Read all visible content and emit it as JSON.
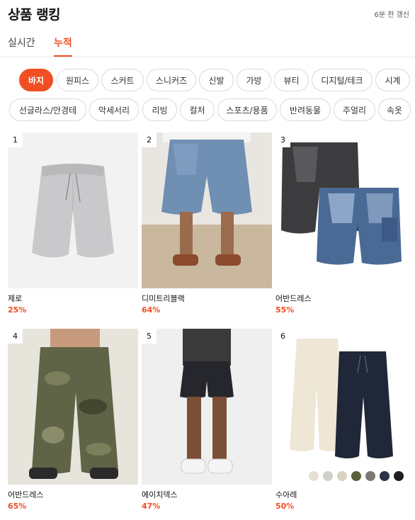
{
  "header": {
    "title": "상품 랭킹",
    "updated": "6분 전 갱신"
  },
  "tabs": [
    {
      "label": "실시간",
      "active": false
    },
    {
      "label": "누적",
      "active": true
    }
  ],
  "categories_row1": [
    "바지",
    "원피스",
    "스커트",
    "스니커즈",
    "신발",
    "가방",
    "뷰티",
    "디지털/테크",
    "시계"
  ],
  "categories_row2": [
    "선글라스/안경테",
    "악세서리",
    "리빙",
    "컬처",
    "스포츠/용품",
    "반려동물",
    "주얼리",
    "속옷"
  ],
  "selected_category": "바지",
  "products": [
    {
      "rank": "1",
      "brand": "제로",
      "discount": "25%",
      "icon": "gray-sweat-shorts"
    },
    {
      "rank": "2",
      "brand": "디미트리블랙",
      "discount": "64%",
      "icon": "denim-shorts-model"
    },
    {
      "rank": "3",
      "brand": "어반드레스",
      "discount": "55%",
      "icon": "cargo-denim-shorts"
    },
    {
      "rank": "4",
      "brand": "어반드레스",
      "discount": "65%",
      "icon": "camo-cargo-pants"
    },
    {
      "rank": "5",
      "brand": "에이치덱스",
      "discount": "47%",
      "icon": "black-athletic-shorts"
    },
    {
      "rank": "6",
      "brand": "수아레",
      "discount": "50%",
      "icon": "wide-pants-pair"
    }
  ],
  "swatch_colors": [
    "#e6e0d2",
    "#cfcfcb",
    "#d8d3c0",
    "#5b5f3d",
    "#7a7a72",
    "#2c3344",
    "#1f1f1f"
  ],
  "accent_color": "#f04e23"
}
